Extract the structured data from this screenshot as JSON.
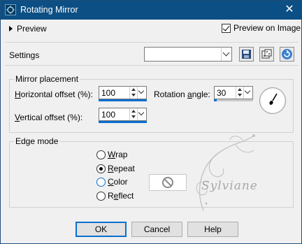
{
  "window": {
    "title": "Rotating Mirror",
    "close_glyph": "✕"
  },
  "preview": {
    "toggle_label": "Preview",
    "on_image_label": "Preview on Image",
    "on_image_checked": true
  },
  "settings": {
    "label": "Settings",
    "preset_value": "",
    "icons": [
      "save-preset-icon",
      "randomize-icon",
      "reset-icon"
    ]
  },
  "mirror_placement": {
    "title": "Mirror placement",
    "horizontal": {
      "label_pre": "",
      "label_u": "H",
      "label_post": "orizontal offset (%):",
      "value": "100"
    },
    "vertical": {
      "label_pre": "",
      "label_u": "V",
      "label_post": "ertical offset (%):",
      "value": "100"
    },
    "rotation": {
      "label_pre": "Rotation ",
      "label_u": "a",
      "label_post": "ngle:",
      "value": "30"
    }
  },
  "edge_mode": {
    "title": "Edge mode",
    "options": [
      {
        "pre": "",
        "u": "W",
        "post": "rap",
        "selected": false
      },
      {
        "pre": "",
        "u": "R",
        "post": "epeat",
        "selected": true
      },
      {
        "pre": "",
        "u": "C",
        "post": "olor",
        "selected": false
      },
      {
        "pre": "R",
        "u": "e",
        "post": "flect",
        "selected": false
      }
    ]
  },
  "watermark": "Sylviane",
  "buttons": {
    "ok": "OK",
    "cancel": "Cancel",
    "help": "Help"
  },
  "colors": {
    "titlebar": "#0c4f84",
    "accent": "#0a6fd0",
    "reset_icon": "#3a7fd0"
  }
}
